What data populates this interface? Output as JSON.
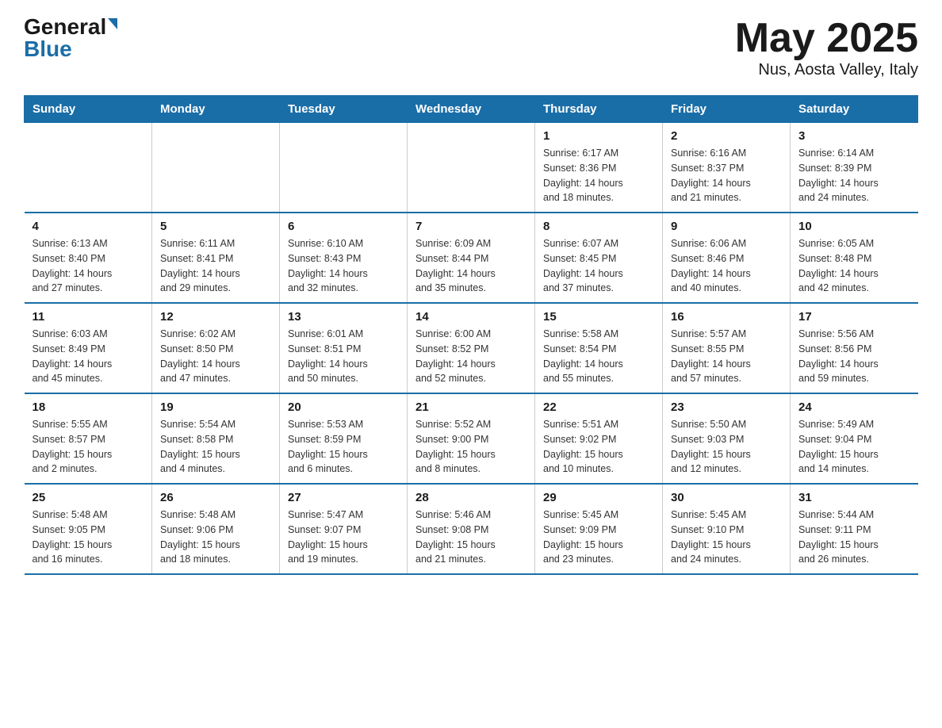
{
  "logo": {
    "general": "General",
    "blue": "Blue"
  },
  "title": "May 2025",
  "location": "Nus, Aosta Valley, Italy",
  "days_of_week": [
    "Sunday",
    "Monday",
    "Tuesday",
    "Wednesday",
    "Thursday",
    "Friday",
    "Saturday"
  ],
  "weeks": [
    [
      {
        "day": "",
        "info": ""
      },
      {
        "day": "",
        "info": ""
      },
      {
        "day": "",
        "info": ""
      },
      {
        "day": "",
        "info": ""
      },
      {
        "day": "1",
        "info": "Sunrise: 6:17 AM\nSunset: 8:36 PM\nDaylight: 14 hours\nand 18 minutes."
      },
      {
        "day": "2",
        "info": "Sunrise: 6:16 AM\nSunset: 8:37 PM\nDaylight: 14 hours\nand 21 minutes."
      },
      {
        "day": "3",
        "info": "Sunrise: 6:14 AM\nSunset: 8:39 PM\nDaylight: 14 hours\nand 24 minutes."
      }
    ],
    [
      {
        "day": "4",
        "info": "Sunrise: 6:13 AM\nSunset: 8:40 PM\nDaylight: 14 hours\nand 27 minutes."
      },
      {
        "day": "5",
        "info": "Sunrise: 6:11 AM\nSunset: 8:41 PM\nDaylight: 14 hours\nand 29 minutes."
      },
      {
        "day": "6",
        "info": "Sunrise: 6:10 AM\nSunset: 8:43 PM\nDaylight: 14 hours\nand 32 minutes."
      },
      {
        "day": "7",
        "info": "Sunrise: 6:09 AM\nSunset: 8:44 PM\nDaylight: 14 hours\nand 35 minutes."
      },
      {
        "day": "8",
        "info": "Sunrise: 6:07 AM\nSunset: 8:45 PM\nDaylight: 14 hours\nand 37 minutes."
      },
      {
        "day": "9",
        "info": "Sunrise: 6:06 AM\nSunset: 8:46 PM\nDaylight: 14 hours\nand 40 minutes."
      },
      {
        "day": "10",
        "info": "Sunrise: 6:05 AM\nSunset: 8:48 PM\nDaylight: 14 hours\nand 42 minutes."
      }
    ],
    [
      {
        "day": "11",
        "info": "Sunrise: 6:03 AM\nSunset: 8:49 PM\nDaylight: 14 hours\nand 45 minutes."
      },
      {
        "day": "12",
        "info": "Sunrise: 6:02 AM\nSunset: 8:50 PM\nDaylight: 14 hours\nand 47 minutes."
      },
      {
        "day": "13",
        "info": "Sunrise: 6:01 AM\nSunset: 8:51 PM\nDaylight: 14 hours\nand 50 minutes."
      },
      {
        "day": "14",
        "info": "Sunrise: 6:00 AM\nSunset: 8:52 PM\nDaylight: 14 hours\nand 52 minutes."
      },
      {
        "day": "15",
        "info": "Sunrise: 5:58 AM\nSunset: 8:54 PM\nDaylight: 14 hours\nand 55 minutes."
      },
      {
        "day": "16",
        "info": "Sunrise: 5:57 AM\nSunset: 8:55 PM\nDaylight: 14 hours\nand 57 minutes."
      },
      {
        "day": "17",
        "info": "Sunrise: 5:56 AM\nSunset: 8:56 PM\nDaylight: 14 hours\nand 59 minutes."
      }
    ],
    [
      {
        "day": "18",
        "info": "Sunrise: 5:55 AM\nSunset: 8:57 PM\nDaylight: 15 hours\nand 2 minutes."
      },
      {
        "day": "19",
        "info": "Sunrise: 5:54 AM\nSunset: 8:58 PM\nDaylight: 15 hours\nand 4 minutes."
      },
      {
        "day": "20",
        "info": "Sunrise: 5:53 AM\nSunset: 8:59 PM\nDaylight: 15 hours\nand 6 minutes."
      },
      {
        "day": "21",
        "info": "Sunrise: 5:52 AM\nSunset: 9:00 PM\nDaylight: 15 hours\nand 8 minutes."
      },
      {
        "day": "22",
        "info": "Sunrise: 5:51 AM\nSunset: 9:02 PM\nDaylight: 15 hours\nand 10 minutes."
      },
      {
        "day": "23",
        "info": "Sunrise: 5:50 AM\nSunset: 9:03 PM\nDaylight: 15 hours\nand 12 minutes."
      },
      {
        "day": "24",
        "info": "Sunrise: 5:49 AM\nSunset: 9:04 PM\nDaylight: 15 hours\nand 14 minutes."
      }
    ],
    [
      {
        "day": "25",
        "info": "Sunrise: 5:48 AM\nSunset: 9:05 PM\nDaylight: 15 hours\nand 16 minutes."
      },
      {
        "day": "26",
        "info": "Sunrise: 5:48 AM\nSunset: 9:06 PM\nDaylight: 15 hours\nand 18 minutes."
      },
      {
        "day": "27",
        "info": "Sunrise: 5:47 AM\nSunset: 9:07 PM\nDaylight: 15 hours\nand 19 minutes."
      },
      {
        "day": "28",
        "info": "Sunrise: 5:46 AM\nSunset: 9:08 PM\nDaylight: 15 hours\nand 21 minutes."
      },
      {
        "day": "29",
        "info": "Sunrise: 5:45 AM\nSunset: 9:09 PM\nDaylight: 15 hours\nand 23 minutes."
      },
      {
        "day": "30",
        "info": "Sunrise: 5:45 AM\nSunset: 9:10 PM\nDaylight: 15 hours\nand 24 minutes."
      },
      {
        "day": "31",
        "info": "Sunrise: 5:44 AM\nSunset: 9:11 PM\nDaylight: 15 hours\nand 26 minutes."
      }
    ]
  ]
}
